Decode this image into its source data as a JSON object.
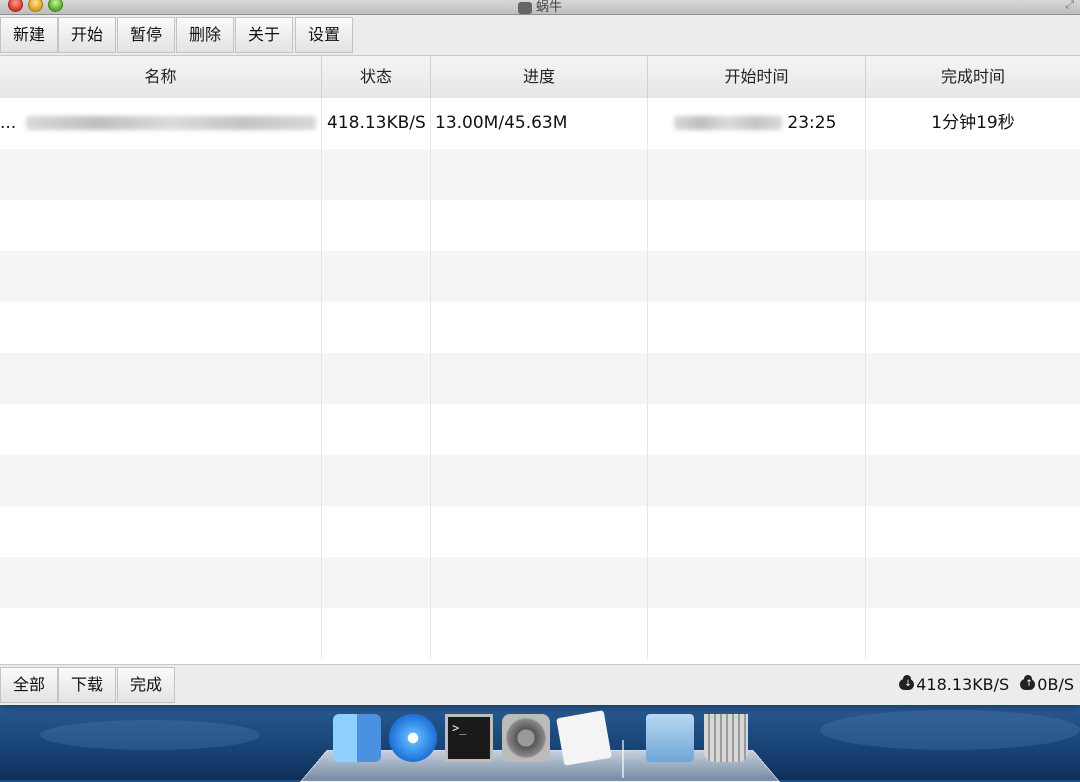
{
  "window": {
    "title": "蜗牛"
  },
  "toolbar": {
    "buttons": [
      "新建",
      "开始",
      "暂停",
      "删除",
      "关于",
      "设置"
    ]
  },
  "table": {
    "columns": [
      "名称",
      "状态",
      "进度",
      "开始时间",
      "完成时间"
    ],
    "rows": [
      {
        "name": "...",
        "status": "418.13KB/S",
        "progress": "13.00M/45.63M",
        "start_time": "23:25",
        "finish_time": "1分钟19秒"
      }
    ]
  },
  "footer": {
    "filters": [
      "全部",
      "下载",
      "完成"
    ],
    "download_speed": "418.13KB/S",
    "upload_speed": "0B/S"
  },
  "dock": {
    "items": [
      "finder-icon",
      "safari-icon",
      "terminal-icon",
      "system-preferences-icon",
      "coffee-app-icon",
      "folder-icon",
      "trash-icon"
    ],
    "terminal_glyph": ">_"
  }
}
